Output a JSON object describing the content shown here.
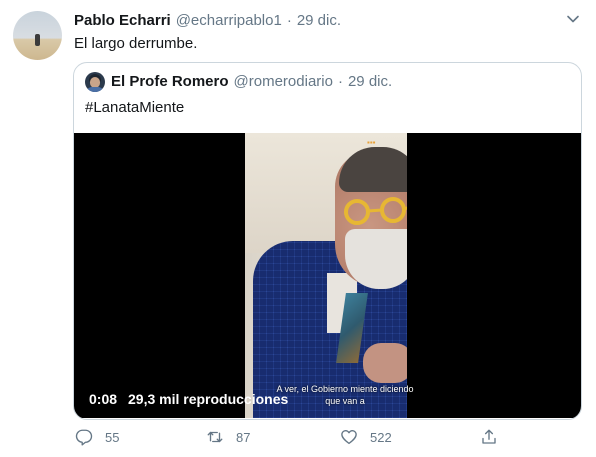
{
  "tweet": {
    "name": "Pablo Echarri",
    "handle": "@echarripablo1",
    "separator": "·",
    "date": "29 dic.",
    "text": "El largo derrumbe."
  },
  "quoted": {
    "name": "El Profe Romero",
    "handle": "@romerodiario",
    "separator": "·",
    "date": "29 dic.",
    "text": "#LanataMiente"
  },
  "video": {
    "time": "0:08",
    "views": "29,3 mil reproducciones",
    "subtitle": "A ver, el Gobierno miente diciendo que van a"
  },
  "actions": {
    "replies": "55",
    "retweets": "87",
    "likes": "522"
  },
  "icons": {
    "menu": "chevron-down-icon",
    "reply": "reply-icon",
    "retweet": "retweet-icon",
    "like": "heart-icon",
    "share": "share-icon"
  },
  "colors": {
    "text_primary": "#14171a",
    "text_secondary": "#657786",
    "border": "#ccd6dd"
  }
}
